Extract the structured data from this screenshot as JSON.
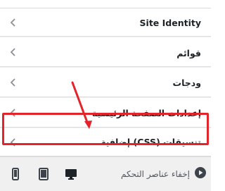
{
  "menu": {
    "items": [
      {
        "label": ""
      },
      {
        "label": "Site Identity"
      },
      {
        "label": "قوائم"
      },
      {
        "label": "ودجات"
      },
      {
        "label": "إعدادات الصفحة الرئيسية"
      },
      {
        "label": "تنسيقات (CSS) إضافية"
      }
    ]
  },
  "annotation": {
    "color": "#e3242b"
  },
  "footer": {
    "collapse_label": "إخفاء عناصر التحكم",
    "devices": [
      "desktop-icon",
      "tablet-icon",
      "mobile-icon"
    ]
  }
}
